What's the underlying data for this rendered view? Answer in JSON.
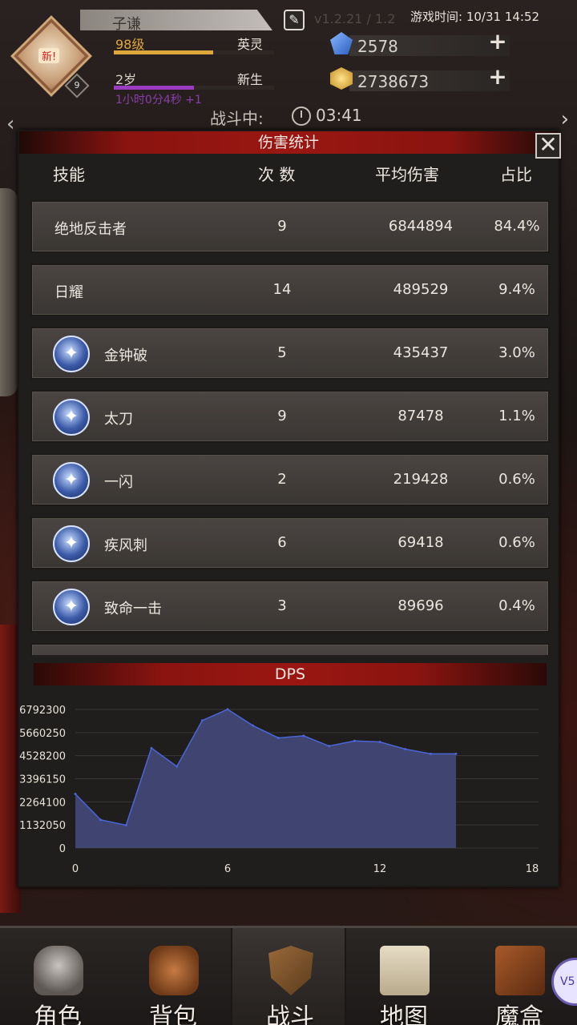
{
  "header": {
    "player_name": "子谦",
    "level": "98级",
    "rank": "英灵",
    "level_progress": 0.62,
    "age": "2岁",
    "life_stage": "新生",
    "age_progress": 0.5,
    "timer": "1小时0分4秒 +1",
    "new_badge": "新!",
    "avatar_level": "9",
    "ghost_text": "v1.2.21 / 1.2",
    "game_time": "游戏时间: 10/31 14:52",
    "gems": "2578",
    "gold": "2738673",
    "battle_status": "战斗中:",
    "battle_time": "03:41"
  },
  "dialog": {
    "title": "伤害统计",
    "columns": {
      "skill": "技能",
      "count": "次 数",
      "avg": "平均伤害",
      "pct": "占比"
    },
    "rows": [
      {
        "name": "绝地反击者",
        "count": "9",
        "avg": "6844894",
        "pct": "84.4%",
        "icon": ""
      },
      {
        "name": "日耀",
        "count": "14",
        "avg": "489529",
        "pct": "9.4%",
        "icon": ""
      },
      {
        "name": "金钟破",
        "count": "5",
        "avg": "435437",
        "pct": "3.0%",
        "icon": "guardian-skill-icon"
      },
      {
        "name": "太刀",
        "count": "9",
        "avg": "87478",
        "pct": "1.1%",
        "icon": "blade-skill-icon"
      },
      {
        "name": "一闪",
        "count": "2",
        "avg": "219428",
        "pct": "0.6%",
        "icon": "flash-skill-icon"
      },
      {
        "name": "疾风刺",
        "count": "6",
        "avg": "69418",
        "pct": "0.6%",
        "icon": "gale-thrust-skill-icon"
      },
      {
        "name": "致命一击",
        "count": "3",
        "avg": "89696",
        "pct": "0.4%",
        "icon": "critical-strike-skill-icon"
      }
    ],
    "close_symbol": "✕"
  },
  "chart_data": {
    "type": "area",
    "title": "DPS",
    "x": [
      0,
      1,
      2,
      3,
      4,
      5,
      6,
      7,
      8,
      9,
      10,
      11,
      12,
      13,
      14,
      15
    ],
    "values": [
      2650000,
      1380000,
      1120000,
      4900000,
      4000000,
      6250000,
      6800000,
      6000000,
      5400000,
      5500000,
      5000000,
      5250000,
      5200000,
      4850000,
      4620000,
      4620000
    ],
    "xlim": [
      0,
      18
    ],
    "ylim": [
      0,
      6792300
    ],
    "x_ticks": [
      "0",
      "6",
      "12",
      "18"
    ],
    "y_ticks": [
      "0",
      "1132050",
      "2264100",
      "3396150",
      "4528200",
      "5660250",
      "6792300"
    ],
    "fill_color": "#404470",
    "line_color": "#4a66d8"
  },
  "nav": {
    "items": [
      {
        "label": "角色",
        "icon": "helmet-icon"
      },
      {
        "label": "背包",
        "icon": "backpack-icon"
      },
      {
        "label": "战斗",
        "icon": "sword-shield-icon"
      },
      {
        "label": "地图",
        "icon": "map-scroll-icon"
      },
      {
        "label": "魔盒",
        "icon": "magic-box-icon"
      }
    ],
    "active": "战斗",
    "side_bubble": "V5"
  }
}
